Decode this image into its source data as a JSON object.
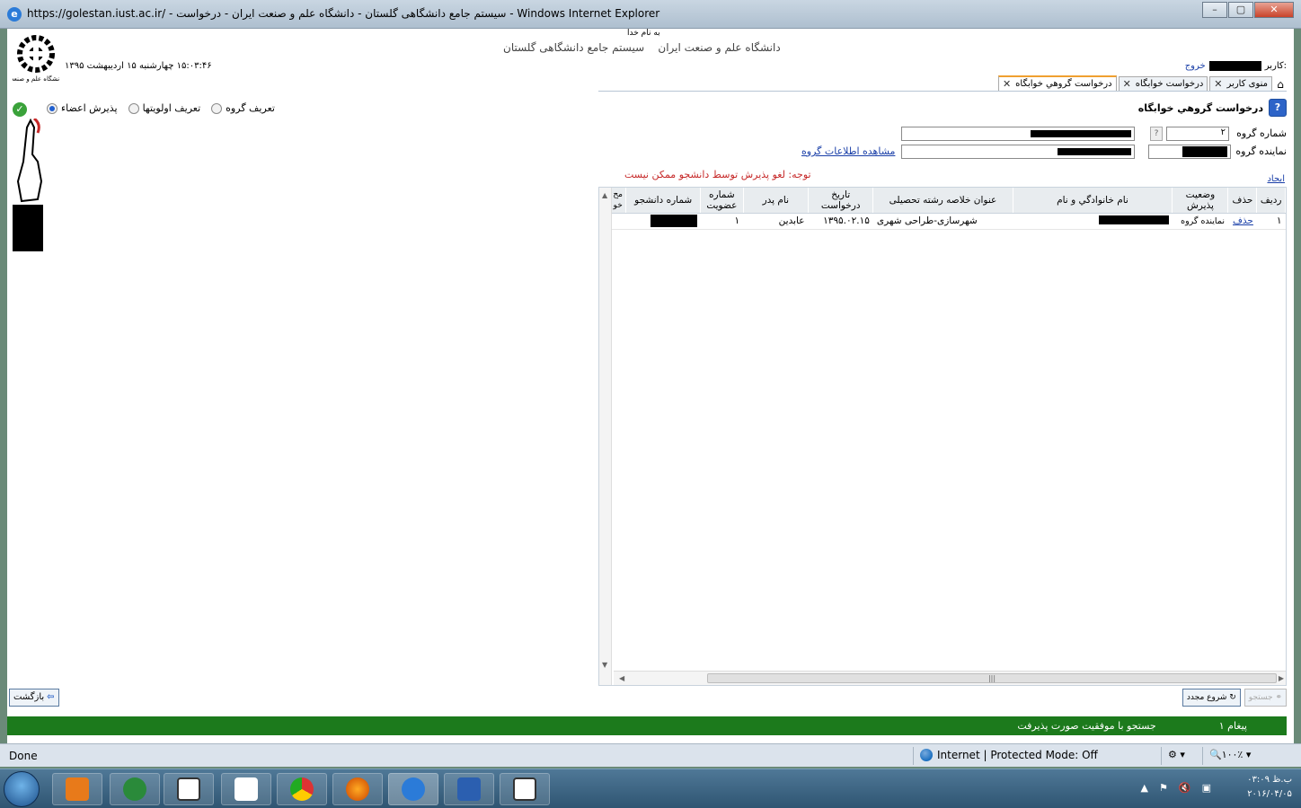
{
  "window": {
    "title": "https://golestan.iust.ac.ir/ - سیستم جامع دانشگاهی گلستان - دانشگاه علم و صنعت ایران - درخواست - Windows Internet Explorer",
    "min_label": "–",
    "max_label": "▢",
    "close_label": "✕"
  },
  "header": {
    "bismillah": "به نام خدا",
    "system_name": "سیستم جامع دانشگاهی گلستان",
    "university": "دانشگاه علم و صنعت ایران",
    "datetime": "۱۵:۰۳:۴۶ چهارشنبه ۱۵ اردیبهشت ۱۳۹۵",
    "user_label": "کاربر:",
    "logout": "خروج"
  },
  "tabs": [
    {
      "label": "منوی کاربر",
      "close": "✕"
    },
    {
      "label": "درخواست خوابگاه",
      "close": "✕"
    },
    {
      "label": "درخواست گروهي خوابگاه",
      "close": "✕",
      "active": true
    }
  ],
  "home_icon": "⌂",
  "radios": {
    "define_group": "تعریف گروه",
    "define_priorities": "تعریف اولویتها",
    "accept_members": "پذیرش اعضاء",
    "selected": "accept_members"
  },
  "check_icon": "✓",
  "form": {
    "help_icon": "?",
    "title": "درخواست گروهي خوابگاه",
    "group_number_label": "شماره گروه",
    "group_number_value": "۲",
    "group_number_btn": "?",
    "group_rep_label": "نماینده گروه",
    "view_group_info": "مشاهده اطلاعات گروه",
    "notice": "توجه: لغو پذیرش توسط دانشجو ممکن نیست",
    "create_link": "ایجاد"
  },
  "table": {
    "headers": [
      "ردیف",
      "حذف",
      "وضعیت پذیرش",
      "نام خانوادگي و نام",
      "عنوان خلاصه رشته تحصیلی",
      "تاریخ درخواست",
      "نام پدر",
      "شماره عضویت",
      "شماره دانشجو",
      "مح خو"
    ],
    "rows": [
      {
        "radif": "۱",
        "delete": "حذف",
        "status": "نماینده گروه",
        "name": "",
        "field": "شهرسازی-طراحی شهری",
        "date": "۱۳۹۵.۰۲.۱۵",
        "father": "عابدین",
        "member_no": "۱",
        "student_no": "",
        "extra": ""
      }
    ]
  },
  "buttons": {
    "back": "بازگشت",
    "start_again": "شروع مجدد",
    "search": "جستجو"
  },
  "message_bar": {
    "count": "۱ پیغام",
    "text": "جستجو با موفقیت صورت پذیرفت"
  },
  "statusbar": {
    "done": "Done",
    "zone": "Internet | Protected Mode: Off",
    "zoom": "۱۰۰٪",
    "dropdown": "▾"
  },
  "taskbar": {
    "time": "ب.ظ ۰۳:۰۹",
    "date": "۲۰۱۶/۰۴/۰۵"
  }
}
